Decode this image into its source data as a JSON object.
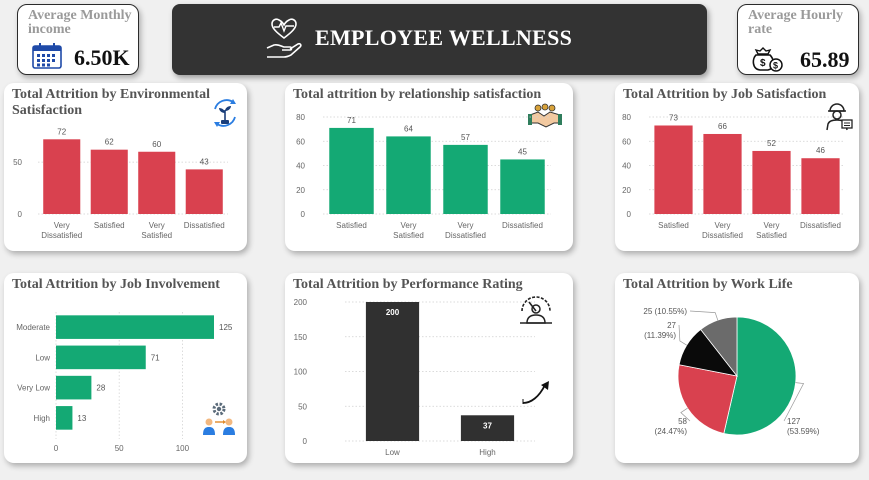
{
  "kpi_income": {
    "title": "Average Monthly income",
    "value": "6.50K"
  },
  "kpi_rate": {
    "title": "Average Hourly rate",
    "value": "65.89"
  },
  "banner": {
    "title": "EMPLOYEE WELLNESS"
  },
  "colors": {
    "red": "#d9414f",
    "green": "#14a974",
    "dark": "#303030",
    "gray": "#6b6b6b",
    "black": "#0a0a0a"
  },
  "icons": [
    "calendar-icon",
    "money-bag-icon",
    "heart-in-hand-icon",
    "plant-cycle-icon",
    "handshake-icon",
    "worker-icon",
    "team-gear-icon",
    "speedometer-icon",
    "trend-arrow-icon"
  ],
  "chart_data": [
    {
      "id": "env",
      "type": "bar",
      "title": "Total Attrition by Environmental Satisfaction",
      "categories": [
        "Very Dissatisfied",
        "Satisfied",
        "Very Satisfied",
        "Dissatisfied"
      ],
      "values": [
        72,
        62,
        60,
        43
      ],
      "yticks": [
        0,
        50
      ],
      "ylim": [
        0,
        80
      ],
      "color": "#d9414f",
      "grid": true
    },
    {
      "id": "rel",
      "type": "bar",
      "title": "Total attrition by relationship satisfaction",
      "categories": [
        "Satisfied",
        "Very Satisfied",
        "Very Dissatisfied",
        "Dissatisfied"
      ],
      "values": [
        71,
        64,
        57,
        45
      ],
      "yticks": [
        0,
        20,
        40,
        60,
        80
      ],
      "ylim": [
        0,
        80
      ],
      "color": "#14a974",
      "grid": true
    },
    {
      "id": "job",
      "type": "bar",
      "title": "Total Attrition by Job Satisfaction",
      "categories": [
        "Satisfied",
        "Very Dissatisfied",
        "Very Satisfied",
        "Dissatisfied"
      ],
      "values": [
        73,
        66,
        52,
        46
      ],
      "yticks": [
        0,
        20,
        40,
        60,
        80
      ],
      "ylim": [
        0,
        80
      ],
      "color": "#d9414f",
      "grid": true
    },
    {
      "id": "inv",
      "type": "bar",
      "orientation": "horizontal",
      "title": "Total Attrition by Job Involvement",
      "categories": [
        "Moderate",
        "Low",
        "Very Low",
        "High"
      ],
      "values": [
        125,
        71,
        28,
        13
      ],
      "xticks": [
        0,
        50,
        100
      ],
      "xlim": [
        0,
        125
      ],
      "color": "#14a974",
      "grid": true
    },
    {
      "id": "perf",
      "type": "bar",
      "title": "Total Attrition by Performance Rating",
      "categories": [
        "Low",
        "High"
      ],
      "values": [
        200,
        37
      ],
      "yticks": [
        0,
        50,
        100,
        150,
        200
      ],
      "ylim": [
        0,
        200
      ],
      "color": "#303030",
      "grid": true
    },
    {
      "id": "wl",
      "type": "pie",
      "title": "Total Attrition by Work Life",
      "slices": [
        {
          "value": 127,
          "pct": "(53.59%)",
          "color": "#14a974"
        },
        {
          "value": 58,
          "pct": "(24.47%)",
          "color": "#d9414f"
        },
        {
          "value": 27,
          "pct": "(11.39%)",
          "color": "#0a0a0a"
        },
        {
          "value": 25,
          "pct": "(10.55%)",
          "color": "#6b6b6b"
        }
      ]
    }
  ]
}
